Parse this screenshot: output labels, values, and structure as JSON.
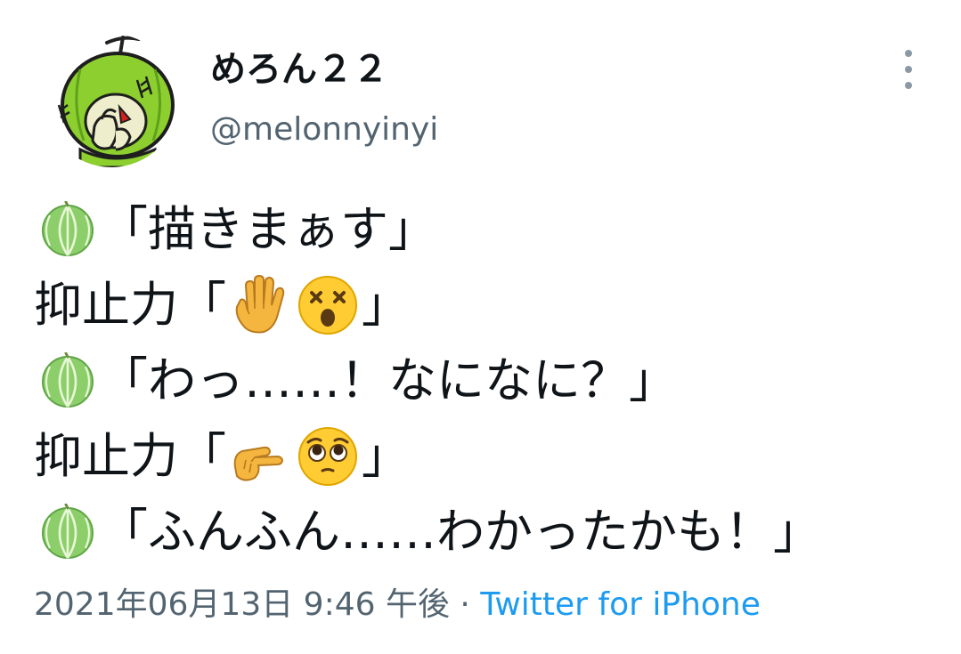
{
  "user": {
    "display_name": "めろん２２",
    "handle": "@melonnyinyi"
  },
  "tweet": {
    "line1_text": "「描きまぁす」",
    "line2_prefix": "抑止力「",
    "line2_suffix": "」",
    "line3_text": "「わっ……！なになに？」",
    "line4_prefix": "抑止力「",
    "line4_suffix": "」",
    "line5_text": "「ふんふん……わかったかも！」"
  },
  "meta": {
    "timestamp": "2021年06月13日 9:46 午後",
    "separator": " · ",
    "source": "Twitter for iPhone"
  },
  "icons": {
    "avatar": "melon-character-avatar",
    "melon": "melon-emoji",
    "hand": "raised-hand-with-fingers-splayed-emoji",
    "dizzy": "dizzy-face-emoji",
    "pinch": "pinching-hand-emoji",
    "pleading": "pleading-face-emoji",
    "more": "more-options-icon"
  },
  "colors": {
    "text": "#0f1419",
    "secondary": "#536471",
    "link": "#1d9bf0",
    "melon_green": "#8fd16b"
  }
}
